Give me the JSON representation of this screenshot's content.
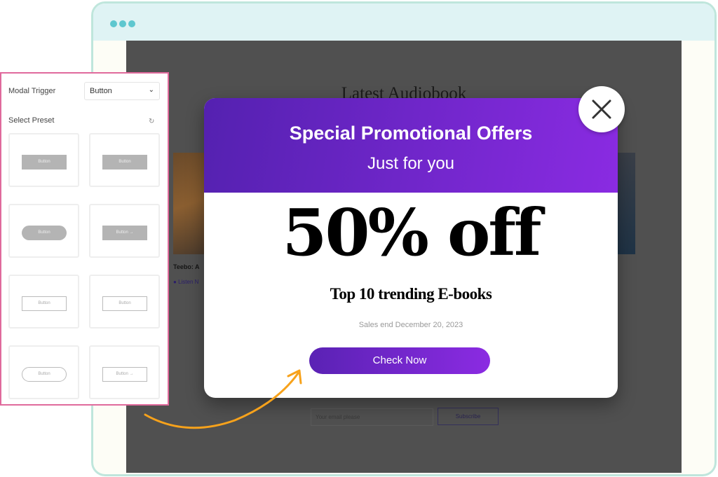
{
  "browser": {
    "dots": 3,
    "dot_color": "#5ec7cf"
  },
  "background_page": {
    "title": "Latest Audiobook",
    "book_title": "Teebo: A",
    "listen_label": "Listen N",
    "email_placeholder": "Your email please",
    "subscribe_label": "Subscribe"
  },
  "panel": {
    "trigger_label": "Modal Trigger",
    "trigger_value": "Button",
    "preset_label": "Select Preset",
    "presets": [
      {
        "label": "Button"
      },
      {
        "label": "Button"
      },
      {
        "label": "Button"
      },
      {
        "label": "Button →"
      },
      {
        "label": "Button"
      },
      {
        "label": "Button"
      },
      {
        "label": "Button"
      },
      {
        "label": "Button →"
      }
    ],
    "border_color": "#e06a9c"
  },
  "modal": {
    "title": "Special Promotional Offers",
    "subtitle": "Just for you",
    "headline": "50% off",
    "tagline": "Top 10 trending E-books",
    "sale_end": "Sales end December 20, 2023",
    "cta_label": "Check Now",
    "accent_start": "#5421b0",
    "accent_end": "#8a2be2"
  },
  "arrow_color": "#f7a21b"
}
